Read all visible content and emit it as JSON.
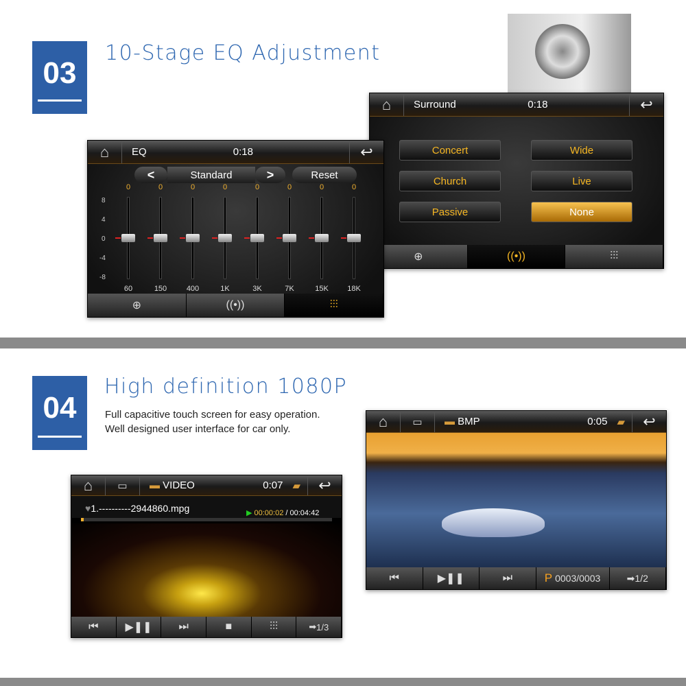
{
  "section3": {
    "number": "03",
    "title": "10-Stage EQ Adjustment"
  },
  "eq_screen": {
    "title": "EQ",
    "time": "0:18",
    "preset": "Standard",
    "reset": "Reset",
    "prev": "<",
    "next": ">",
    "scale": [
      "8",
      "4",
      "0",
      "-4",
      "-8"
    ],
    "bands": [
      {
        "label": "60",
        "value": 0
      },
      {
        "label": "150",
        "value": 0
      },
      {
        "label": "400",
        "value": 0
      },
      {
        "label": "1K",
        "value": 0
      },
      {
        "label": "3K",
        "value": 0
      },
      {
        "label": "7K",
        "value": 0
      },
      {
        "label": "15K",
        "value": 0
      },
      {
        "label": "18K",
        "value": 0
      }
    ],
    "values_text": [
      "0",
      "0",
      "0",
      "0",
      "0",
      "0",
      "0",
      "0"
    ],
    "bottom_tabs": [
      {
        "icon": "balance-icon",
        "glyph": "⊕"
      },
      {
        "icon": "surround-icon",
        "glyph": "((•))"
      },
      {
        "icon": "eq-icon",
        "glyph": "⫶⫶⫶",
        "active": true
      }
    ]
  },
  "surround_screen": {
    "title": "Surround",
    "time": "0:18",
    "options": [
      "Concert",
      "Wide",
      "Church",
      "Live",
      "Passive",
      "None"
    ],
    "selected": "None",
    "bottom_tabs": [
      {
        "icon": "balance-icon",
        "glyph": "⊕"
      },
      {
        "icon": "surround-icon",
        "glyph": "((•))",
        "active": true
      },
      {
        "icon": "eq-icon",
        "glyph": "⫶⫶⫶"
      }
    ]
  },
  "section4": {
    "number": "04",
    "title": "High definition 1080P",
    "desc1": "Full capacitive touch screen for easy operation.",
    "desc2": "Well designed user interface for car only."
  },
  "video_screen": {
    "title": "VIDEO",
    "time": "0:07",
    "filename": "1.----------2944860.mpg",
    "elapsed": "00:00:02",
    "total": "/ 00:04:42",
    "progress": 0.01,
    "page": "1/3"
  },
  "photo_screen": {
    "title": "BMP",
    "time": "0:05",
    "counter_prefix": "P",
    "counter": "0003/0003",
    "page": "1/2"
  },
  "colors": {
    "accent_blue": "#2d5fa6",
    "highlight_orange": "#f5b623",
    "divider_gray": "#8a8a8a"
  }
}
